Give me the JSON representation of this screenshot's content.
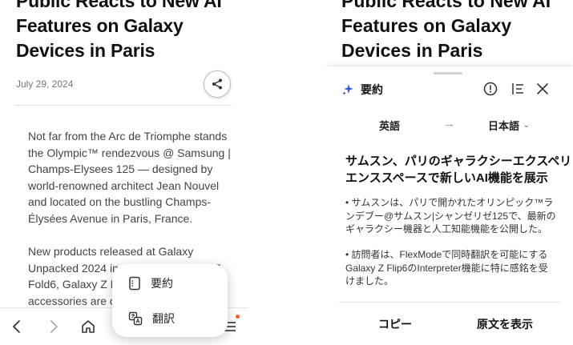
{
  "left": {
    "headline_lines": [
      "Public Reacts to New AI",
      "Features on Galaxy",
      "Devices in Paris"
    ],
    "date": "July 29, 2024",
    "paragraph1_lines": [
      "Not far from the Arc de Triomphe stands",
      "the Olympic™ rendezvous @ Samsung |",
      "Champs-Elysees 125 — designed by",
      "world-renowned architect Jean Nouvel",
      "and located on the bustling Champs-",
      "Élysées Avenue in Paris, France."
    ],
    "paragraph2_lines": [
      "New products released at Galaxy",
      "Unpacked 2024 including the Galaxy Z",
      "Fold6, Galaxy Z Fli",
      "accessories are on"
    ],
    "popup": {
      "summary_label": "要約",
      "translate_label": "翻訳"
    },
    "nav_icons": [
      "back-icon",
      "forward-icon",
      "home-icon",
      "menu-icon"
    ]
  },
  "right": {
    "headline_lines": [
      "Public Reacts to New AI",
      "Features on Galaxy",
      "Devices in Paris"
    ],
    "sheet": {
      "title": "要約",
      "source_language": "英語",
      "arrow": "→",
      "target_language": "日本語",
      "summary_title_lines": [
        "サムスン、パリのギャラクシーエクスペリ",
        "エンススペースで新しいAI機能を展示"
      ],
      "bullet1_lines": [
        "• サムスンは、パリで開かれたオリンピック™ラ",
        "ンデブー@サムスン|シャンゼリゼ125で、最新の",
        "ギャラクシー機器と人工知能機能を公開した。"
      ],
      "bullet2_lines": [
        "• 訪問者は、FlexModeで同時翻訳を可能にする",
        "Galaxy Z Flip6のInterpreter機能に特に感銘を受",
        "けました。"
      ],
      "copy_label": "コピー",
      "show_original_label": "原文を表示"
    }
  },
  "colors": {
    "accent_sparkle": "#3a5bd9",
    "notification_dot": "#f2662d",
    "body_text": "#444444"
  }
}
